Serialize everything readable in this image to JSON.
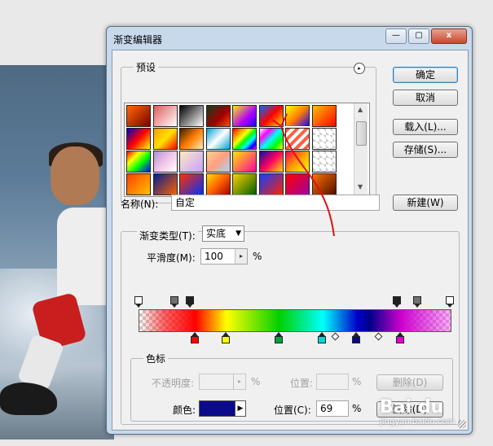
{
  "window": {
    "title": "渐变编辑器",
    "min_label": "—",
    "max_label": "▢",
    "close_label": "x"
  },
  "presets": {
    "label": "预设",
    "menu_icon": "circle-arrow-icon",
    "swatch_gradients": [
      "linear-gradient(135deg,#ff6a00,#7a0000)",
      "linear-gradient(135deg,#e05a5a 0%,#fff 100%)",
      "linear-gradient(135deg,#000,#fff)",
      "linear-gradient(135deg,#1a3a1a,#a40000 60%,#ff4f00)",
      "linear-gradient(135deg,#ffeb00,#b200ff 60%,#1a00ff)",
      "linear-gradient(135deg,#006dff,#ff0000 50%,#ffe000)",
      "linear-gradient(135deg,#ffff00,#ff7f00 50%,#1a00ff)",
      "linear-gradient(135deg,#ffbf00,#ff0000)",
      "linear-gradient(135deg,#0000c8,#ff0000 50%,#ffff00)",
      "linear-gradient(135deg,#ff9e00,#ffe100 50%,#ff0000)",
      "linear-gradient(135deg,#3a1d00,#ff7a00 50%,#fff0b0)",
      "linear-gradient(135deg,#00a0d8,#fff 50%,#00a0d8)",
      "linear-gradient(135deg,#ff0000,#ff8800 20%,#ffff00 40%,#00ff00 55%,#00ffff 70%,#0000ff 85%,#ff00ff)",
      "linear-gradient(135deg,#fff 0%,#ff00ff 25%,#00ffff 50%,#00ff00 75%,#ffff00 100%)",
      "repeating-linear-gradient(135deg,#ff6040 0 4px,#fff 4px 8px)",
      "linear-gradient(45deg,#ccc 25%,transparent 25%,transparent 75%,#ccc 75%) 0 0/8px 8px, #fff",
      "linear-gradient(135deg,#ff0000,#ffff00 30%,#00ff00 60%,#0000ff)",
      "linear-gradient(135deg,#b28fd4,#f2c6e8 50%,#fff)",
      "linear-gradient(135deg,#ffe8c0,#c8a0ff)",
      "linear-gradient(135deg,#ffd090,#ff9f80 50%,#a0d8ff)",
      "linear-gradient(135deg,#ffe800,#ff00a0)",
      "linear-gradient(135deg,#1010a0,#ff0060 50%,#ffe000)",
      "linear-gradient(135deg,#ff0050,#ff9f00 50%,#ffff00)",
      "linear-gradient(45deg,#ccc 25%,transparent 25%,transparent 75%,#ccc 75%) 0 0/8px 8px, #fff",
      "linear-gradient(135deg,#ff4000,#ffc000)",
      "linear-gradient(135deg,#002090,#ff6000)",
      "linear-gradient(135deg,#ff3000,#0030ff)",
      "linear-gradient(135deg,#ffe000,#ff6000 50%,#a00000)",
      "linear-gradient(135deg,#ffd000,#006000)",
      "linear-gradient(135deg,#1040ff,#ff2000)",
      "linear-gradient(135deg,#ff0000,#a000a0)",
      "linear-gradient(135deg,#ff7000,#501000)"
    ]
  },
  "buttons": {
    "ok": "确定",
    "cancel": "取消",
    "load": "载入(L)...",
    "save": "存储(S)...",
    "new": "新建(W)"
  },
  "name": {
    "label": "名称(N):",
    "value": "自定"
  },
  "gradient_type": {
    "label": "渐变类型(T):",
    "value": "实底"
  },
  "smoothness": {
    "label": "平滑度(M):",
    "value": "100",
    "unit": "%"
  },
  "stops": {
    "opacity_stops": [
      {
        "pos": 0,
        "color": "#ffffff"
      },
      {
        "pos": 0.115,
        "color": "#707070"
      },
      {
        "pos": 0.165,
        "color": "#202020"
      },
      {
        "pos": 0.83,
        "color": "#202020"
      },
      {
        "pos": 0.895,
        "color": "#707070"
      },
      {
        "pos": 1.0,
        "color": "#ffffff"
      }
    ],
    "color_stops": [
      {
        "pos": 0.18,
        "color": "#ff0000"
      },
      {
        "pos": 0.28,
        "color": "#ffff00"
      },
      {
        "pos": 0.45,
        "color": "#00a040"
      },
      {
        "pos": 0.59,
        "color": "#00d8e0"
      },
      {
        "pos": 0.7,
        "color": "#0a0a80"
      },
      {
        "pos": 0.84,
        "color": "#e000d0"
      }
    ],
    "midpoints": [
      0.63,
      0.77
    ]
  },
  "color_stop_group": {
    "label": "色标",
    "opacity_label": "不透明度:",
    "opacity_unit": "%",
    "location_label_top": "位置:",
    "location_unit_top": "%",
    "delete_top": "删除(D)",
    "color_label": "颜色:",
    "color_value": "#0a0a8a",
    "location_label": "位置(C):",
    "location_value": "69",
    "location_unit": "%",
    "delete_bottom": "删除(D)"
  },
  "watermark": {
    "logo": "Bai du",
    "url": "jingyan.baidu.com"
  }
}
